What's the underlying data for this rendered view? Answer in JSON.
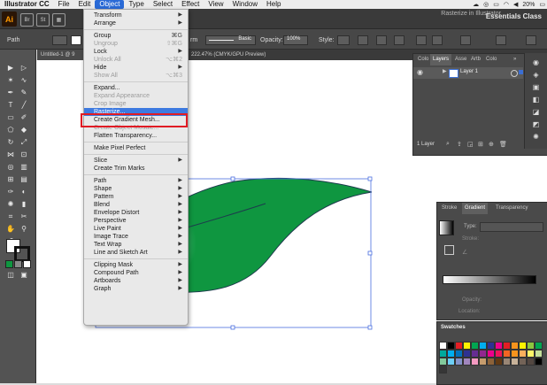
{
  "menubar": {
    "app_name": "Illustrator CC",
    "items": [
      "File",
      "Edit",
      "Object",
      "Type",
      "Select",
      "Effect",
      "View",
      "Window",
      "Help"
    ],
    "battery": "20%"
  },
  "appbar": {
    "logo": "Ai",
    "workspace": "Essentials Class",
    "ghost_title": "Rasterize in Illustrator"
  },
  "controlbar": {
    "selection_label": "Path",
    "stroke_style": "Basic",
    "opacity_label": "Opacity:",
    "opacity_value": "100%",
    "style_label": "Style:",
    "partial_label": "rm"
  },
  "doc": {
    "tab1": "Untitled-1 @ 9",
    "tab2": "222.47% (CMYK/GPU Preview)"
  },
  "menu": {
    "items": [
      {
        "label": "Transform",
        "submenu": true
      },
      {
        "label": "Arrange",
        "submenu": true
      },
      {
        "sep": true
      },
      {
        "label": "Group",
        "shortcut": "⌘G"
      },
      {
        "label": "Ungroup",
        "shortcut": "⇧⌘G",
        "disabled": true
      },
      {
        "label": "Lock",
        "submenu": true
      },
      {
        "label": "Unlock All",
        "shortcut": "⌥⌘2",
        "disabled": true
      },
      {
        "label": "Hide",
        "submenu": true
      },
      {
        "label": "Show All",
        "shortcut": "⌥⌘3",
        "disabled": true
      },
      {
        "sep": true
      },
      {
        "label": "Expand..."
      },
      {
        "label": "Expand Appearance",
        "disabled": true
      },
      {
        "label": "Crop Image",
        "disabled": true
      },
      {
        "label": "Rasterize...",
        "selected": true
      },
      {
        "label": "Create Gradient Mesh..."
      },
      {
        "label": "Create Object Mosaic...",
        "disabled": true
      },
      {
        "label": "Flatten Transparency..."
      },
      {
        "sep": true
      },
      {
        "label": "Make Pixel Perfect"
      },
      {
        "sep": true
      },
      {
        "label": "Slice",
        "submenu": true
      },
      {
        "label": "Create Trim Marks"
      },
      {
        "sep": true
      },
      {
        "label": "Path",
        "submenu": true
      },
      {
        "label": "Shape",
        "submenu": true
      },
      {
        "label": "Pattern",
        "submenu": true
      },
      {
        "label": "Blend",
        "submenu": true
      },
      {
        "label": "Envelope Distort",
        "submenu": true
      },
      {
        "label": "Perspective",
        "submenu": true
      },
      {
        "label": "Live Paint",
        "submenu": true
      },
      {
        "label": "Image Trace",
        "submenu": true
      },
      {
        "label": "Text Wrap",
        "submenu": true
      },
      {
        "label": "Line and Sketch Art",
        "submenu": true
      },
      {
        "sep": true
      },
      {
        "label": "Clipping Mask",
        "submenu": true
      },
      {
        "label": "Compound Path",
        "submenu": true
      },
      {
        "label": "Artboards",
        "submenu": true
      },
      {
        "label": "Graph",
        "submenu": true
      }
    ]
  },
  "layers": {
    "tabs": [
      "Colo",
      "Layers",
      "Asse",
      "Artb",
      "Colo"
    ],
    "active_tab": "Layers",
    "layer_name": "Layer 1",
    "count": "1 Layer",
    "layer_color": "#3b6fd4"
  },
  "gradient": {
    "tabs": [
      "Stroke",
      "Gradient",
      "Transparency"
    ],
    "type_label": "Type:",
    "stroke_label": "Stroke:",
    "opacity_label": "Opacity:",
    "location_label": "Location:"
  },
  "swatches": {
    "title": "Swatches",
    "colors": [
      "#ffffff",
      "#000000",
      "#e31e24",
      "#fff200",
      "#00a651",
      "#00aeef",
      "#2e3192",
      "#ec008c",
      "#e31e24",
      "#f7941d",
      "#fff200",
      "#8dc63f",
      "#00a651",
      "#00a99d",
      "#00aeef",
      "#0072bc",
      "#2e3192",
      "#662d91",
      "#92278f",
      "#ec008c",
      "#ed145b",
      "#f26522",
      "#f7941d",
      "#fbaf5d",
      "#fff568",
      "#c4df9b",
      "#82ca9c",
      "#6dcff6",
      "#8393ca",
      "#a186be",
      "#f49ac1",
      "#c69c6d",
      "#8c6239",
      "#603913",
      "#998675",
      "#c7b299",
      "#736357",
      "#534741",
      "#000000",
      "#363636"
    ]
  },
  "colors": {
    "leaf": "#0f9640",
    "selection": "#4a6ee0",
    "highlight_box": "#e01b24"
  }
}
